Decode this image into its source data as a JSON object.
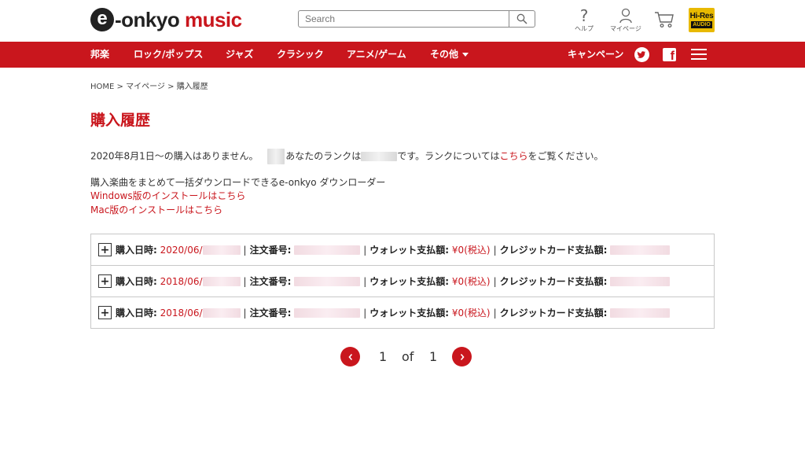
{
  "header": {
    "logo_mark": "e",
    "logo_dark": "-onkyo ",
    "logo_red": "music",
    "search_placeholder": "Search",
    "help_label": "ヘルプ",
    "mypage_label": "マイページ",
    "hires_line1": "Hi-Res",
    "hires_line2": "AUDIO",
    "help_glyph": "?"
  },
  "nav": {
    "items": [
      "邦楽",
      "ロック/ポップス",
      "ジャズ",
      "クラシック",
      "アニメ/ゲーム",
      "その他"
    ],
    "campaign": "キャンペーン",
    "facebook_glyph": "f"
  },
  "breadcrumb": {
    "home": "HOME",
    "sep": ">",
    "mypage": "マイページ",
    "current": "購入履歴"
  },
  "page": {
    "title": "購入履歴",
    "no_purchase": "2020年8月1日～の購入はありません。",
    "rank_prefix": "あなたのランクは",
    "rank_suffix": "です。ランクについては",
    "rank_link": "こちら",
    "rank_end": "をご覧ください。",
    "downloader_text": "購入楽曲をまとめて一括ダウンロードできるe-onkyo ダウンローダー",
    "windows_link": "Windows版のインストールはこちら",
    "mac_link": "Mac版のインストールはこちら"
  },
  "orders": {
    "label_date": "購入日時:",
    "label_order_no": "注文番号:",
    "label_wallet": "ウォレット支払額:",
    "label_card": "クレジットカード支払額:",
    "divider": "|",
    "expand_glyph": "+",
    "rows": [
      {
        "date": "2020/06/",
        "wallet": "¥0(税込)"
      },
      {
        "date": "2018/06/",
        "wallet": "¥0(税込)"
      },
      {
        "date": "2018/06/",
        "wallet": "¥0(税込)"
      }
    ]
  },
  "pagination": {
    "current": "1",
    "of": "of",
    "total": "1"
  },
  "colors": {
    "brand_red": "#c9161d",
    "hires_gold": "#e8b900"
  }
}
